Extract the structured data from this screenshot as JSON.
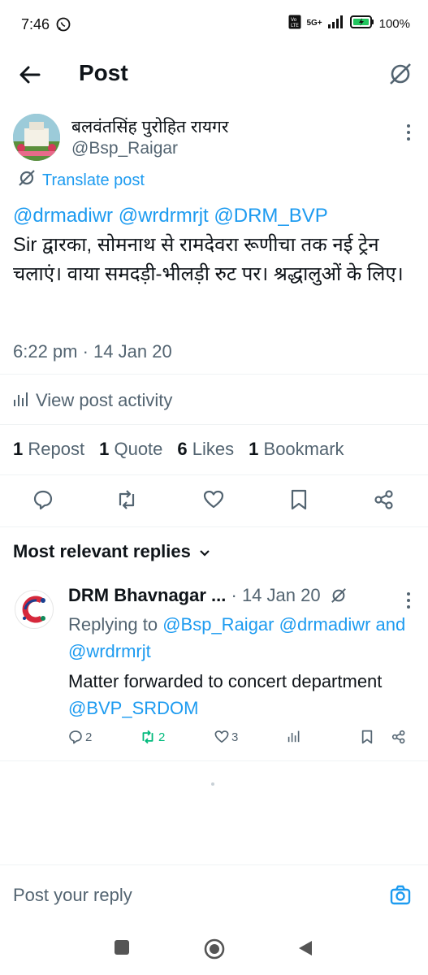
{
  "status_bar": {
    "time": "7:46",
    "network": "5G+",
    "battery": "100%",
    "icons": [
      "whatsapp-icon",
      "volte-icon",
      "signal-icon",
      "battery-icon"
    ]
  },
  "header": {
    "title": "Post",
    "icons": [
      "back-arrow-icon",
      "grok-icon"
    ]
  },
  "post": {
    "author_name": "बलवंतसिंह पुरोहित रायगर",
    "author_handle": "@Bsp_Raigar",
    "translate_label": "Translate post",
    "mentions": "@drmadiwr @wrdrmrjt @DRM_BVP",
    "text": "Sir द्वारका, सोमनाथ से रामदेवरा रूणीचा तक नई ट्रेन चलाएं। वाया समदड़ी-भीलड़ी रुट पर। श्रद्धालुओं के लिए।",
    "time": "6:22 pm · 14 Jan 20",
    "activity_label": "View post activity",
    "counts": {
      "reposts": "1",
      "reposts_label": "Repost",
      "quotes": "1",
      "quotes_label": "Quote",
      "likes": "6",
      "likes_label": "Likes",
      "bookmarks": "1",
      "bookmarks_label": "Bookmark"
    },
    "action_icons": [
      "reply-icon",
      "repost-icon",
      "like-icon",
      "bookmark-icon",
      "share-icon"
    ]
  },
  "replies_section": {
    "heading": "Most relevant replies"
  },
  "reply": {
    "name": "DRM Bhavnagar ...",
    "date": "· 14 Jan 20",
    "replying_prefix": "Replying to",
    "replying_to_1": "@Bsp_Raigar",
    "replying_to_2": "@drmadiwr",
    "replying_and": "and",
    "replying_to_3": "@wrdrmrjt",
    "text": "Matter forwarded to concert department",
    "text_mention": "@BVP_SRDOM",
    "replies_count": "2",
    "reposts_count": "2",
    "likes_count": "3"
  },
  "compose": {
    "placeholder": "Post your reply"
  },
  "colors": {
    "accent": "#1d9bf0",
    "text": "#0f1419",
    "secondary": "#536471",
    "repost_green": "#00ba7c"
  }
}
